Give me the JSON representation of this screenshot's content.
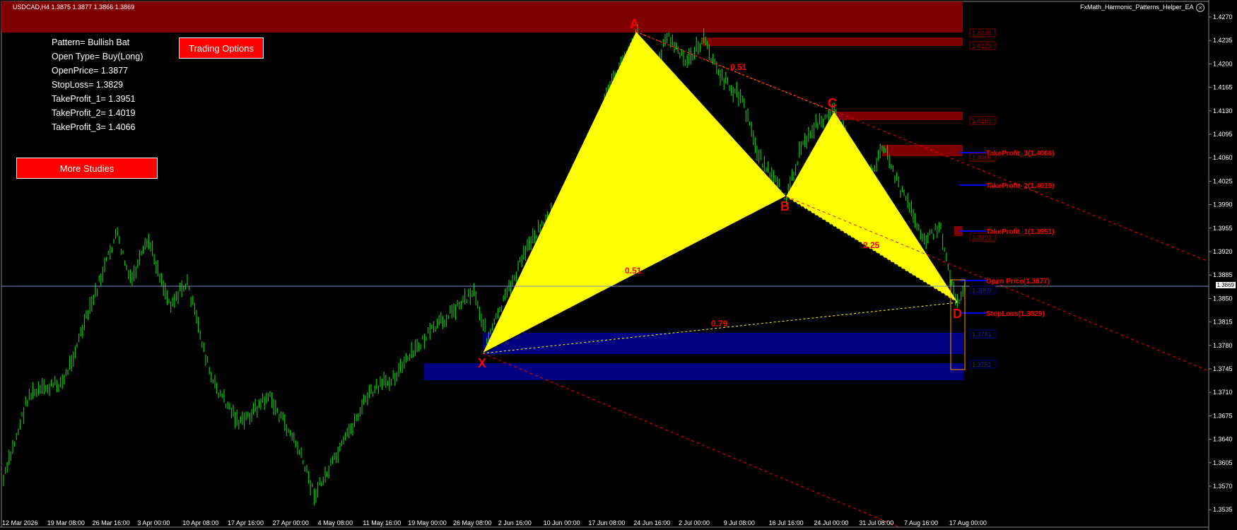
{
  "header": {
    "symbol_info": "USDCAD,H4  1.3875 1.3877 1.3866 1.3869",
    "ea_name": "FxMath_Harmonic_Patterns_Helper_EA",
    "close_glyph": "×"
  },
  "info_panel": {
    "lines": [
      "Pattern= Bullish Bat",
      "Open Type= Buy(Long)",
      "OpenPrice= 1.3877",
      "StopLoss= 1.3829",
      "TakeProfit_1= 1.3951",
      "TakeProfit_2= 1.4019",
      "TakeProfit_3= 1.4066"
    ]
  },
  "buttons": {
    "trading_options": "Trading Options",
    "more_studies": "More Studies"
  },
  "pattern": {
    "points": {
      "X": "X",
      "A": "A",
      "B": "B",
      "C": "C",
      "D": "D"
    },
    "ratios": {
      "xab": "0.51",
      "xb": "0.51",
      "bcd": "2.25",
      "xd": "0.79"
    }
  },
  "levels": {
    "take_profit_3": "TakeProfit_3(1.4066)",
    "take_profit_2": "TakeProfit_2(1.4019)",
    "take_profit_1": "TakeProfit_1(1.3951)",
    "open_price": "Open Price(1.3877)",
    "stop_loss": "StopLoss(1.3829)"
  },
  "zone_labels": {
    "z1": "1.4245",
    "z2": "1.4223",
    "z3": "1.4115",
    "z4": "1.4066",
    "z5": "1.3951",
    "z6": "1.3869",
    "z7": "1.3781",
    "z8": "1.3751"
  },
  "current_price": "1.3869",
  "y_axis_ticks": [
    "1.4270",
    "1.4235",
    "1.4200",
    "1.4165",
    "1.4130",
    "1.4095",
    "1.4060",
    "1.4025",
    "1.3990",
    "1.3955",
    "1.3920",
    "1.3885",
    "1.3850",
    "1.3815",
    "1.3780",
    "1.3745",
    "1.3710",
    "1.3675",
    "1.3640",
    "1.3605",
    "1.3570",
    "1.3535"
  ],
  "x_axis_ticks": [
    "12 Mar 2026",
    "19 Mar 08:00",
    "26 Mar 16:00",
    "3 Apr 00:00",
    "10 Apr 08:00",
    "17 Apr 16:00",
    "27 Apr 00:00",
    "4 May 08:00",
    "11 May 16:00",
    "19 May 00:00",
    "26 May 08:00",
    "2 Jun 16:00",
    "10 Jun 00:00",
    "17 Jun 08:00",
    "24 Jun 16:00",
    "2 Jul 00:00",
    "9 Jul 08:00",
    "16 Jul 16:00",
    "24 Jul 00:00",
    "31 Jul 08:00",
    "7 Aug 16:00",
    "17 Aug 00:00"
  ],
  "colors": {
    "background": "#000000",
    "candles": "#00c800",
    "pattern_fill": "#ffff00",
    "supply_zone": "#800000",
    "demand_zone": "#000080",
    "button": "#ff0000",
    "label_red": "#ff0000",
    "level_line": "#0000ff"
  }
}
